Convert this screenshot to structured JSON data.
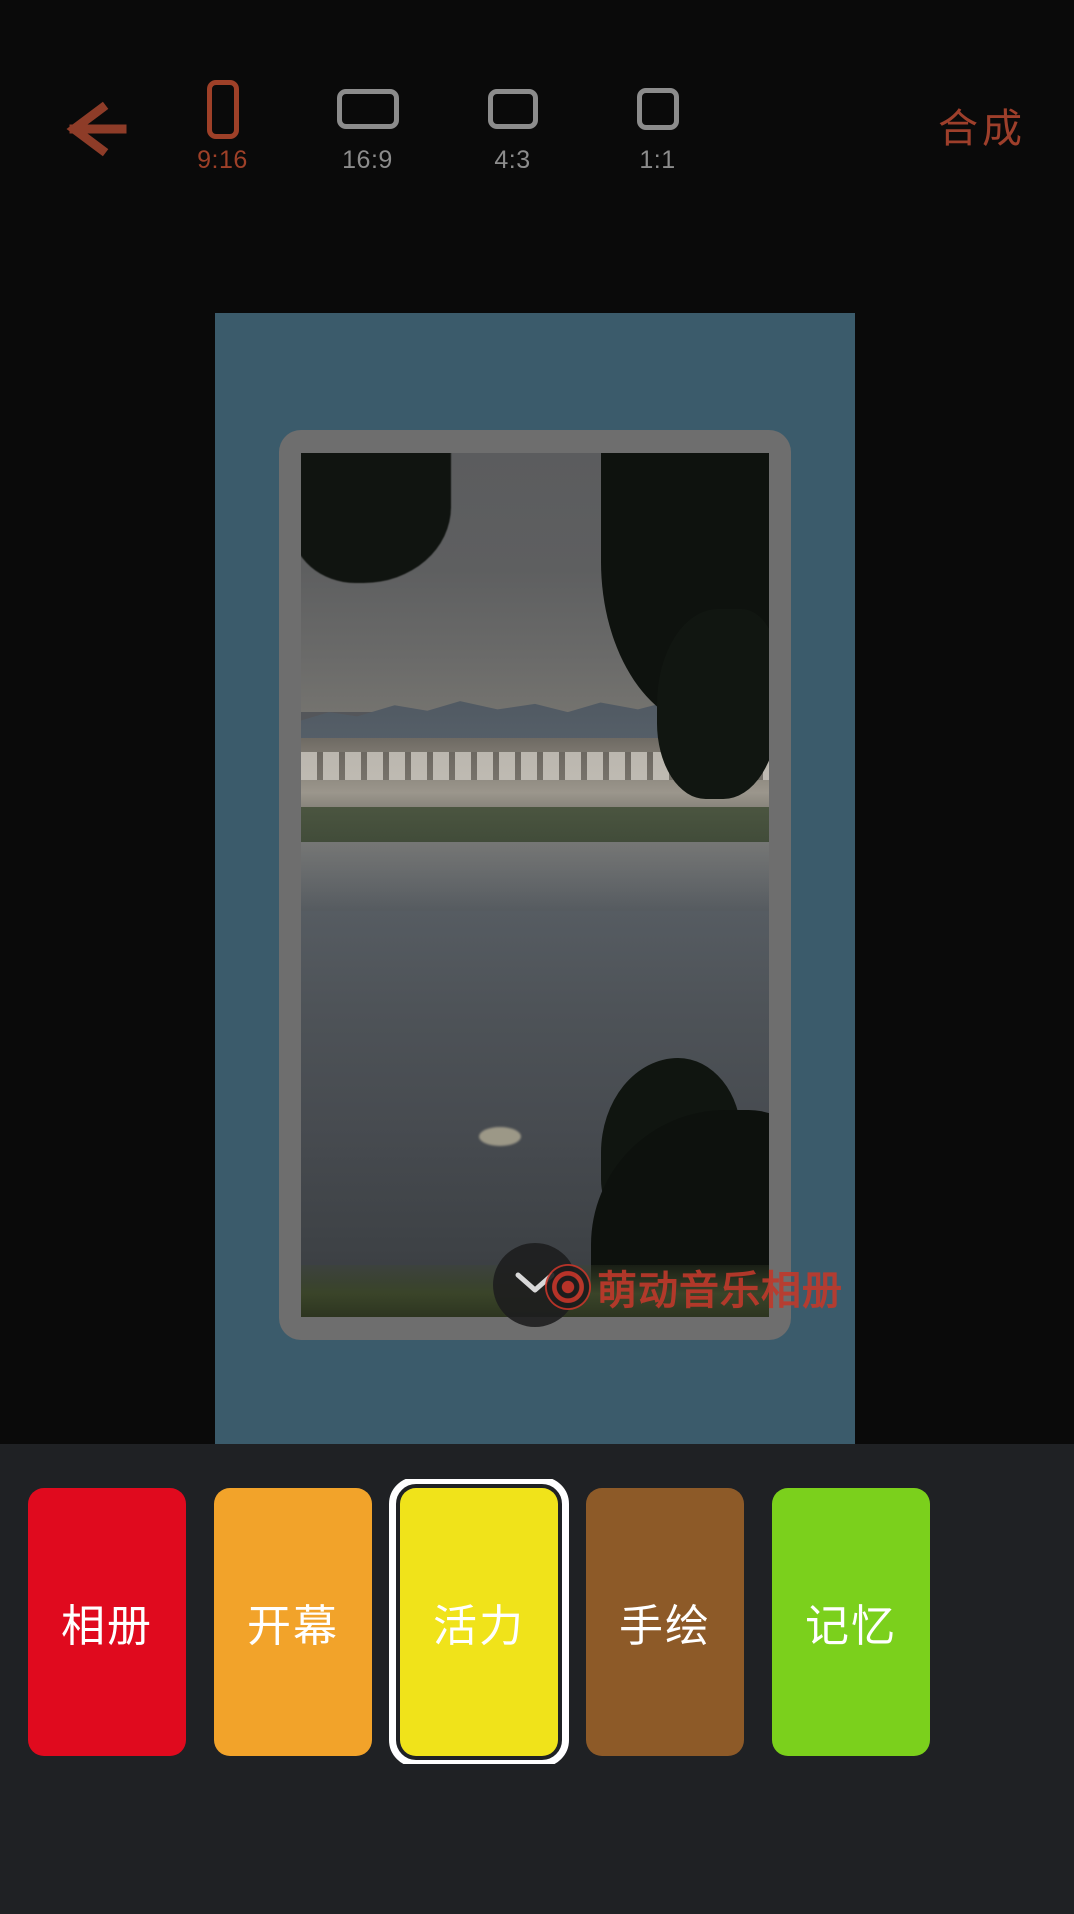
{
  "toolbar": {
    "back_icon": "arrow-left-icon",
    "compose_label": "合成",
    "accent_color": "#9e3f2b",
    "inactive_color": "#8c8c8c",
    "ratios": [
      {
        "label": "9:16",
        "icon": "portrait-rect-icon",
        "selected": true
      },
      {
        "label": "16:9",
        "icon": "landscape-rect-icon",
        "selected": false
      },
      {
        "label": "4:3",
        "icon": "rect-4-3-icon",
        "selected": false
      },
      {
        "label": "1:1",
        "icon": "square-icon",
        "selected": false
      }
    ]
  },
  "preview": {
    "canvas_background_color": "#3b5b6b",
    "frame_color": "#6e6e6e",
    "photo_description": "落日湖景 - 山脉、白墙村落与水面倒影",
    "collapse_icon": "chevron-down-icon",
    "watermark": {
      "logo_icon": "vinyl-record-icon",
      "text": "萌动音乐相册",
      "color": "#c0392b"
    }
  },
  "themes": {
    "selected_index": 2,
    "items": [
      {
        "label": "相册",
        "color": "#e00a1e",
        "selected": false
      },
      {
        "label": "开幕",
        "color": "#f2a32a",
        "selected": false
      },
      {
        "label": "活力",
        "color": "#f0e31a",
        "selected": true
      },
      {
        "label": "手绘",
        "color": "#8d5a28",
        "selected": false
      },
      {
        "label": "记忆",
        "color": "#7bd01c",
        "selected": false
      }
    ]
  }
}
